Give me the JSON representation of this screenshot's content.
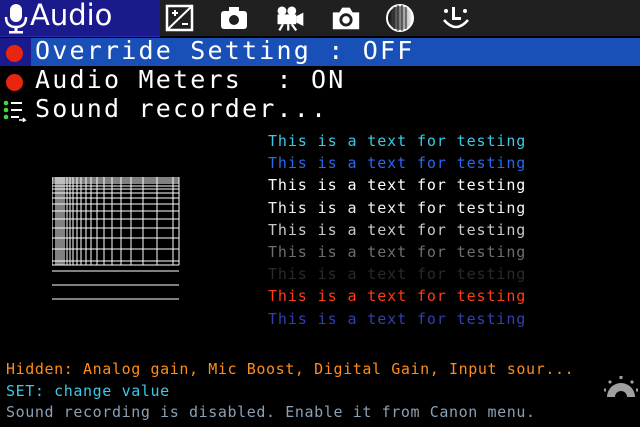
{
  "tab_bar": {
    "active_tab_label": "Audio",
    "icons": [
      "microphone-icon",
      "exposure-icon",
      "camera-body-icon",
      "movie-camera-icon",
      "photo-camera-icon",
      "focus-icon",
      "smiley-icon"
    ]
  },
  "menu": {
    "items": [
      {
        "label": "Override Setting : OFF",
        "selected": true
      },
      {
        "label": "Audio Meters  : ON"
      },
      {
        "label": "Sound recorder..."
      }
    ]
  },
  "test_lines": [
    {
      "text": "This is a text for testing",
      "color": "#3cc8e8"
    },
    {
      "text": "This is a text for testing",
      "color": "#2868f0"
    },
    {
      "text": "This is a text for testing",
      "color": "#ffffff"
    },
    {
      "text": "This is a text for testing",
      "color": "#f0f0f0"
    },
    {
      "text": "This is a text for testing",
      "color": "#c8c8c8"
    },
    {
      "text": "This is a text for testing",
      "color": "#6e6e6e"
    },
    {
      "text": "This is a text for testing",
      "color": "#2a2a2a"
    },
    {
      "text": "This is a text for testing",
      "color": "#ff3c14"
    },
    {
      "text": "This is a text for testing",
      "color": "#3040b0"
    }
  ],
  "footer": {
    "hidden_text": "Hidden: Analog gain, Mic Boost, Digital Gain, Input sour...",
    "set_text": "SET: change value",
    "status_text": "Sound recording is disabled. Enable it from Canon menu."
  },
  "colors": {
    "active_tab": "#1a1a8c",
    "selection": "#1850b8",
    "bullet": "#e8260f",
    "hidden_text": "#ff8c1a",
    "set_text": "#3cc8e8",
    "status_text": "#8aa0b4"
  }
}
